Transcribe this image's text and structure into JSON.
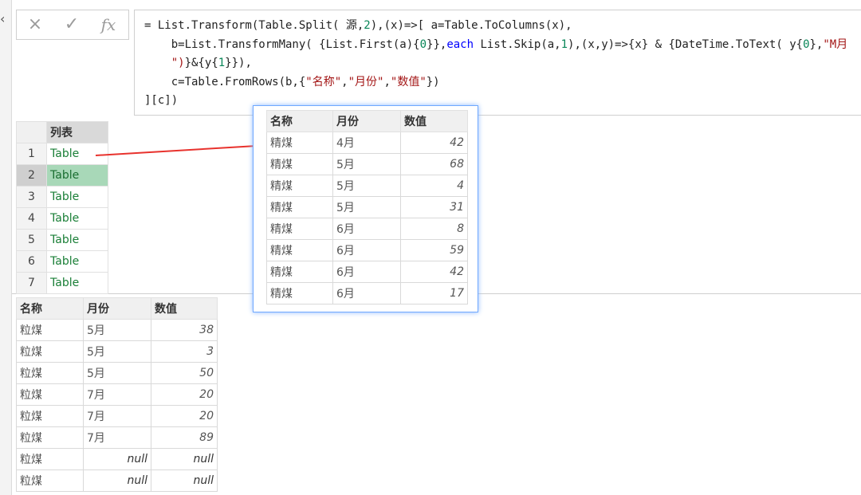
{
  "formula_bar": {
    "cancel_icon": "×",
    "confirm_icon": "✓",
    "fx_label": "fx"
  },
  "formula": {
    "line1_a": "= List.Transform(Table.Split( 源,",
    "line1_num": "2",
    "line1_b": "),(x)=>[ a=Table.ToColumns(x),",
    "line2_a": "    b=List.TransformMany( {List.First(a){",
    "line2_n0": "0",
    "line2_b": "}},",
    "line2_kw": "each",
    "line2_c": " List.Skip(a,",
    "line2_n1": "1",
    "line2_d": "),(x,y)=>{x} & {DateTime.ToText( y{",
    "line2_n2": "0",
    "line2_e": "},",
    "line2_str": "\"M月",
    "line3_str": "    \")",
    "line3_a": "}&{y{",
    "line3_n": "1",
    "line3_b": "}}),",
    "line4_a": "    c=Table.FromRows(b,{",
    "line4_s1": "\"名称\"",
    "line4_s2": "\"月份\"",
    "line4_s3": "\"数值\"",
    "line4_b": "})",
    "line5": "][c])"
  },
  "list_table": {
    "header": "列表",
    "rows": [
      {
        "n": "1",
        "v": "Table"
      },
      {
        "n": "2",
        "v": "Table"
      },
      {
        "n": "3",
        "v": "Table"
      },
      {
        "n": "4",
        "v": "Table"
      },
      {
        "n": "5",
        "v": "Table"
      },
      {
        "n": "6",
        "v": "Table"
      },
      {
        "n": "7",
        "v": "Table"
      }
    ],
    "selected_row": 2
  },
  "popup_table": {
    "headers": [
      "名称",
      "月份",
      "数值"
    ],
    "rows": [
      [
        "精煤",
        "4月",
        "42"
      ],
      [
        "精煤",
        "5月",
        "68"
      ],
      [
        "精煤",
        "5月",
        "4"
      ],
      [
        "精煤",
        "5月",
        "31"
      ],
      [
        "精煤",
        "6月",
        "8"
      ],
      [
        "精煤",
        "6月",
        "59"
      ],
      [
        "精煤",
        "6月",
        "42"
      ],
      [
        "精煤",
        "6月",
        "17"
      ]
    ]
  },
  "bottom_table": {
    "headers": [
      "名称",
      "月份",
      "数值"
    ],
    "rows": [
      [
        "粒煤",
        "5月",
        "38"
      ],
      [
        "粒煤",
        "5月",
        "3"
      ],
      [
        "粒煤",
        "5月",
        "50"
      ],
      [
        "粒煤",
        "7月",
        "20"
      ],
      [
        "粒煤",
        "7月",
        "20"
      ],
      [
        "粒煤",
        "7月",
        "89"
      ],
      [
        "粒煤",
        "null",
        "null"
      ],
      [
        "粒煤",
        "null",
        "null"
      ]
    ]
  },
  "colors": {
    "arrow": "#e8322d",
    "table_link": "#1a7f37",
    "selected_fill": "#a8d8b8",
    "popup_border": "#6fa8ff"
  }
}
